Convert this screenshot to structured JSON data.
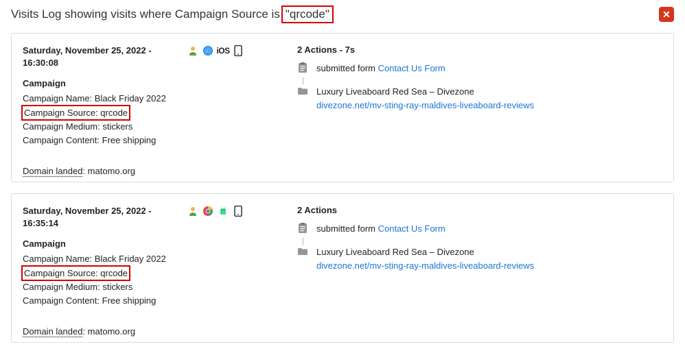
{
  "title_prefix": "Visits Log showing visits where Campaign Source is",
  "title_highlight": "\"qrcode\"",
  "close_glyph": "✕",
  "visits": [
    {
      "datetime": "Saturday, November 25, 2022 - 16:30:08",
      "campaign_label": "Campaign",
      "campaign_name": "Campaign Name: Black Friday 2022",
      "campaign_source": "Campaign Source: qrcode",
      "campaign_medium": "Campaign Medium: stickers",
      "campaign_content": "Campaign Content: Free shipping",
      "domain_landed_label": "Domain landed",
      "domain_landed_value": ": matomo.org",
      "os_label": "iOS",
      "browser": "safari",
      "actions_header": "2 Actions - 7s",
      "action1_text": "submitted form ",
      "action1_link": "Contact Us Form",
      "action2_title": "Luxury Liveaboard Red Sea – Divezone",
      "action2_link": "divezone.net/mv-sting-ray-maldives-liveaboard-reviews"
    },
    {
      "datetime": "Saturday, November 25, 2022 - 16:35:14",
      "campaign_label": "Campaign",
      "campaign_name": "Campaign Name: Black Friday 2022",
      "campaign_source": "Campaign Source: qrcode",
      "campaign_medium": "Campaign Medium: stickers",
      "campaign_content": "Campaign Content: Free shipping",
      "domain_landed_label": "Domain landed",
      "domain_landed_value": ": matomo.org",
      "os_label": "android",
      "browser": "chrome",
      "actions_header": "2 Actions",
      "action1_text": "submitted form ",
      "action1_link": "Contact Us Form",
      "action2_title": "Luxury Liveaboard Red Sea – Divezone",
      "action2_link": "divezone.net/mv-sting-ray-maldives-liveaboard-reviews"
    }
  ]
}
